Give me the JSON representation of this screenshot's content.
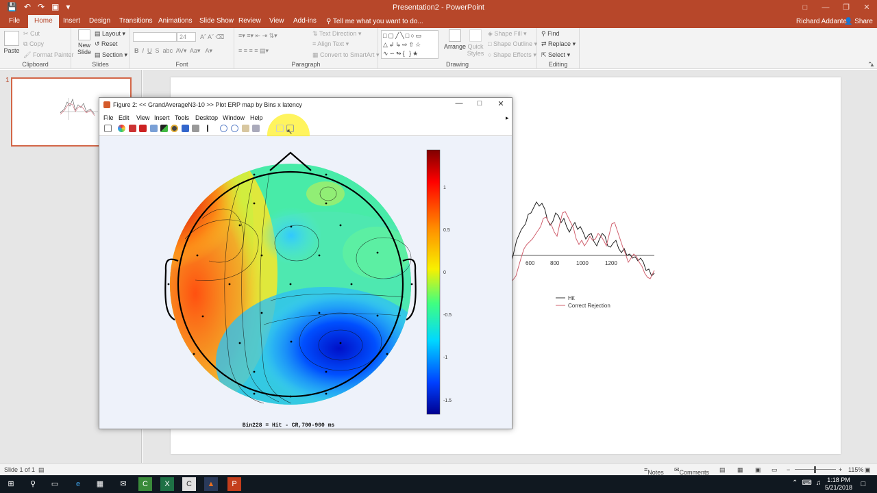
{
  "app": {
    "title": "Presentation2 - PowerPoint",
    "user": "Richard Addante",
    "share_label": "Share",
    "tell_me_placeholder": "Tell me what you want to do..."
  },
  "ribbon_tabs": [
    "File",
    "Home",
    "Insert",
    "Design",
    "Transitions",
    "Animations",
    "Slide Show",
    "Review",
    "View",
    "Add-ins"
  ],
  "active_tab": "Home",
  "ribbon": {
    "clipboard": {
      "label": "Clipboard",
      "paste": "Paste",
      "cut": "Cut",
      "copy": "Copy",
      "format_painter": "Format Painter"
    },
    "slides": {
      "label": "Slides",
      "new_slide": "New Slide",
      "layout": "Layout",
      "reset": "Reset",
      "section": "Section"
    },
    "font": {
      "label": "Font",
      "size": "24"
    },
    "paragraph": {
      "label": "Paragraph",
      "text_direction": "Text Direction",
      "align_text": "Align Text",
      "convert_smartart": "Convert to SmartArt"
    },
    "drawing": {
      "label": "Drawing",
      "arrange": "Arrange",
      "quick_styles": "Quick Styles",
      "shape_fill": "Shape Fill",
      "shape_outline": "Shape Outline",
      "shape_effects": "Shape Effects"
    },
    "editing": {
      "label": "Editing",
      "find": "Find",
      "replace": "Replace",
      "select": "Select"
    }
  },
  "thumbnail": {
    "number": "1"
  },
  "slide": {
    "erp_ticks": [
      "600",
      "800",
      "1000",
      "1200"
    ],
    "legend": [
      {
        "name": "Hit",
        "color": "#333333"
      },
      {
        "name": "Correct Rejection",
        "color": "#d0606e"
      }
    ]
  },
  "figure": {
    "title": "Figure 2: << GrandAverageN3-10 >>   Plot ERP map by Bins x latency",
    "menu": [
      "File",
      "Edit",
      "View",
      "Insert",
      "Tools",
      "Desktop",
      "Window",
      "Help"
    ],
    "caption": "Bin228 = Hit - CR,700-900 ms",
    "colorbar_ticks": [
      "1",
      "0.5",
      "0",
      "-0.5",
      "-1",
      "-1.5"
    ]
  },
  "statusbar": {
    "slide_info": "Slide 1 of 1",
    "notes": "Notes",
    "comments": "Comments",
    "zoom": "115%"
  },
  "taskbar": {
    "time": "1:18 PM",
    "date": "5/21/2018"
  },
  "colors": {
    "accent": "#b7472a",
    "ribbon_bg": "#f3f3f3",
    "taskbar": "#101820"
  }
}
